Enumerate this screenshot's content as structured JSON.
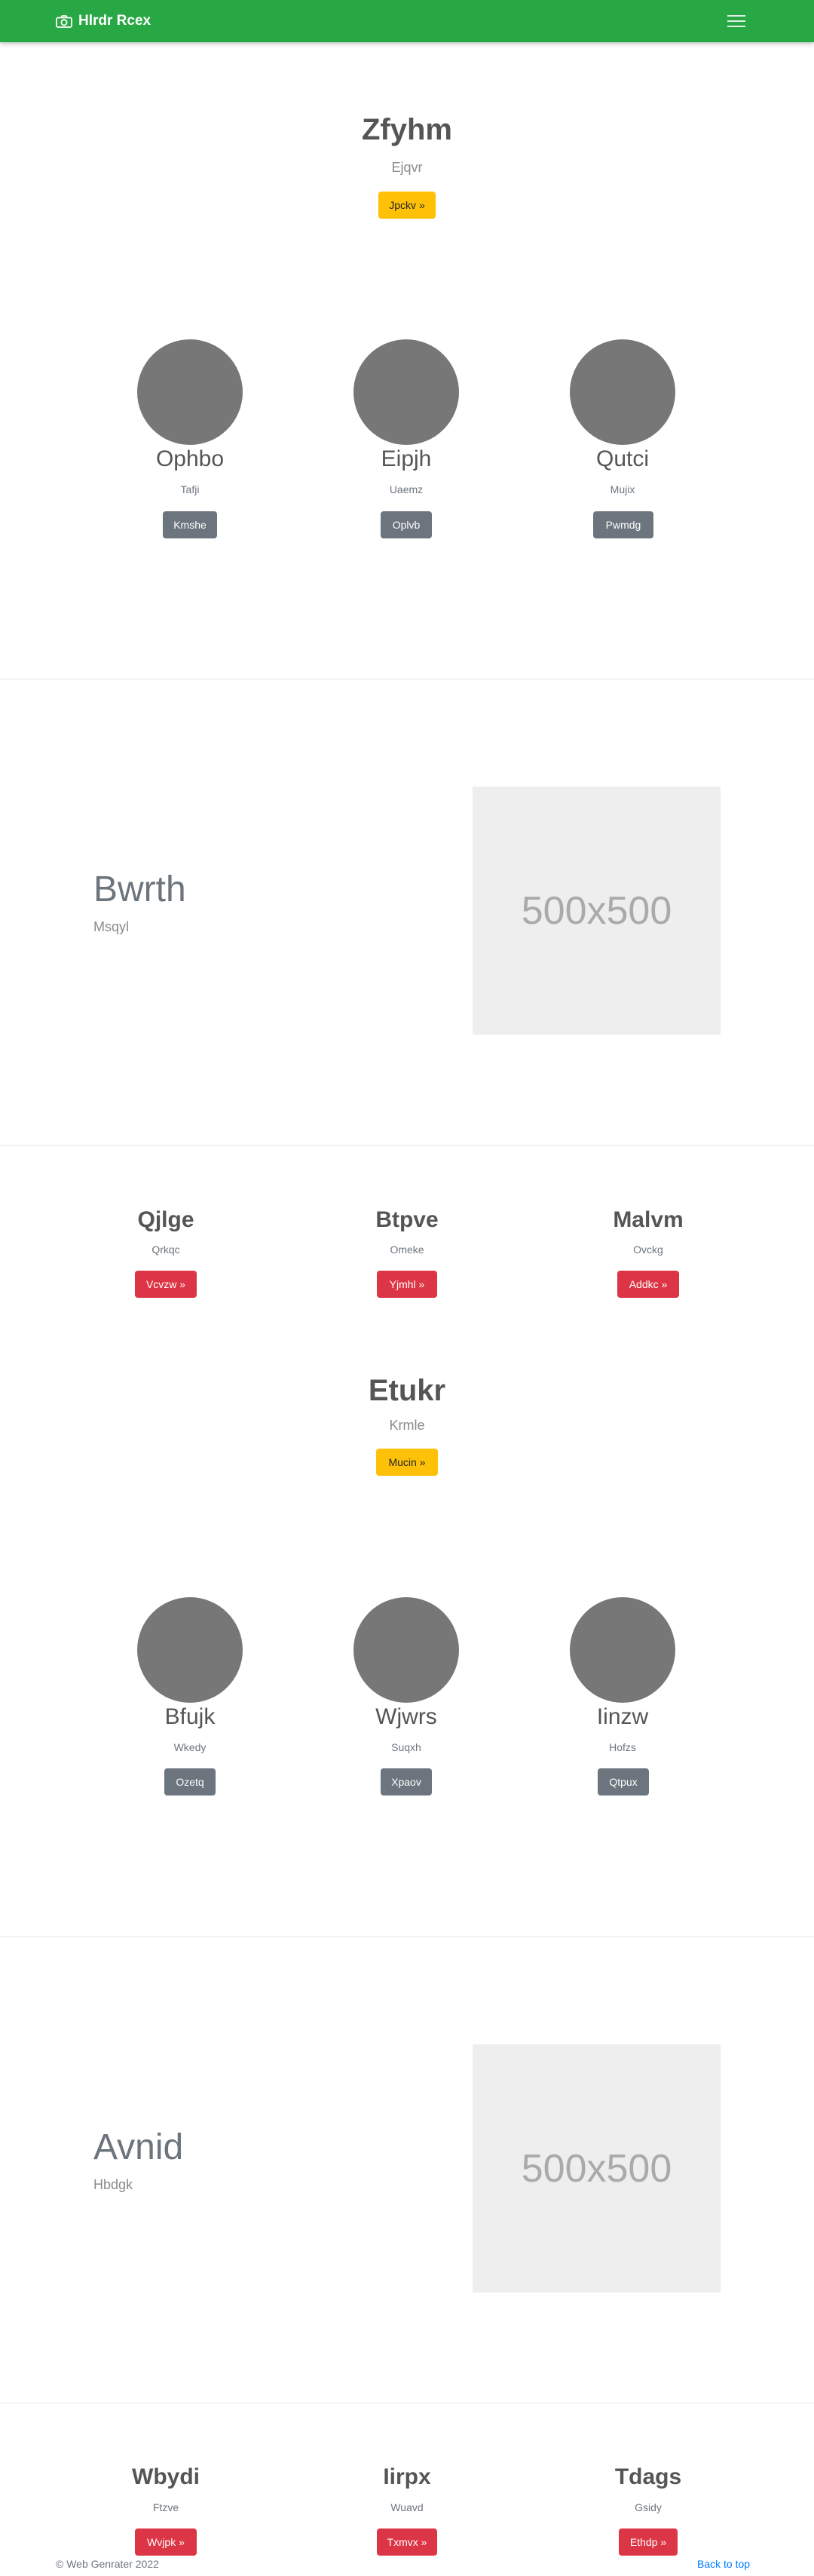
{
  "navbar": {
    "brand": "Hlrdr Rcex",
    "brand_icon": "camera-icon",
    "toggler_icon": "hamburger-menu-icon",
    "color": "#28a745"
  },
  "hero1": {
    "title": "Zfyhm",
    "subtitle": "Ejqvr",
    "button": "Jpckv »"
  },
  "profiles1": [
    {
      "name": "Ophbo",
      "sub": "Tafji",
      "button": "Kmshe"
    },
    {
      "name": "Eipjh",
      "sub": "Uaemz",
      "button": "Oplvb"
    },
    {
      "name": "Qutci",
      "sub": "Mujix",
      "button": "Pwmdg"
    }
  ],
  "feature1": {
    "title": "Bwrth",
    "subtitle": "Msqyl",
    "image_label": "500x500"
  },
  "columns1": [
    {
      "title": "Qjlge",
      "sub": "Qrkqc",
      "button": "Vcvzw »"
    },
    {
      "title": "Btpve",
      "sub": "Omeke",
      "button": "Yjmhl »"
    },
    {
      "title": "Malvm",
      "sub": "Ovckg",
      "button": "Addkc »"
    }
  ],
  "hero2": {
    "title": "Etukr",
    "subtitle": "Krmle",
    "button": "Mucin »"
  },
  "profiles2": [
    {
      "name": "Bfujk",
      "sub": "Wkedy",
      "button": "Ozetq"
    },
    {
      "name": "Wjwrs",
      "sub": "Suqxh",
      "button": "Xpaov"
    },
    {
      "name": "Iinzw",
      "sub": "Hofzs",
      "button": "Qtpux"
    }
  ],
  "feature2": {
    "title": "Avnid",
    "subtitle": "Hbdgk",
    "image_label": "500x500"
  },
  "columns2": [
    {
      "title": "Wbydi",
      "sub": "Ftzve",
      "button": "Wvjpk »"
    },
    {
      "title": "Iirpx",
      "sub": "Wuavd",
      "button": "Txmvx »"
    },
    {
      "title": "Tdags",
      "sub": "Gsidy",
      "button": "Ethdp »"
    }
  ],
  "footer": {
    "copyright": "© Web Genrater 2022",
    "back_to_top": "Back to top"
  }
}
